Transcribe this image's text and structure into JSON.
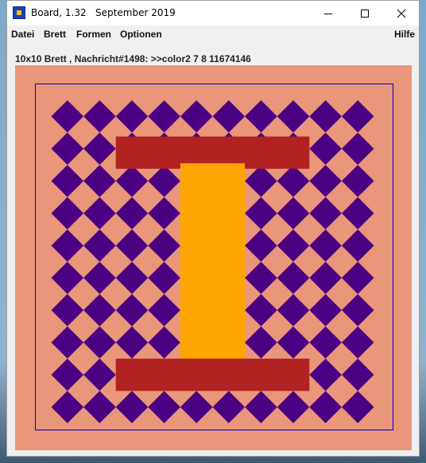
{
  "window": {
    "title": "Board, 1.32   September 2019",
    "icon": "board-app-icon",
    "controls": [
      "minimize-icon",
      "maximize-icon",
      "close-icon"
    ]
  },
  "menu": {
    "items": [
      "Datei",
      "Brett",
      "Formen",
      "Optionen"
    ],
    "help": "Hilfe"
  },
  "status": "10x10 Brett , Nachricht#1498: >>color2 7 8 11674146",
  "board": {
    "size": 10,
    "colors": {
      "background": "#e9967a",
      "frame": "#0000cc",
      "diamond": "#4b0082",
      "bar": "#b22222",
      "column": "#ffa500"
    }
  }
}
